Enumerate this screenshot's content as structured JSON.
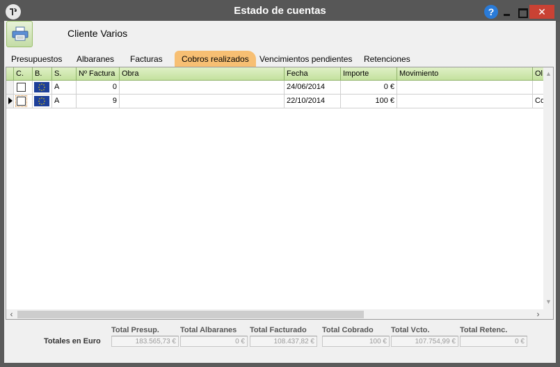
{
  "window": {
    "title": "Estado de cuentas",
    "help_label": "?",
    "close_label": "✕"
  },
  "client": {
    "name": "Cliente Varios"
  },
  "tabs": [
    {
      "label": "Presupuestos",
      "active": false
    },
    {
      "label": "Albaranes",
      "active": false
    },
    {
      "label": "Facturas",
      "active": false
    },
    {
      "label": "Cobros realizados",
      "active": true
    },
    {
      "label": "Vencimientos pendientes",
      "active": false
    },
    {
      "label": "Retenciones",
      "active": false
    }
  ],
  "grid": {
    "columns": [
      "C.",
      "B.",
      "S.",
      "Nº Factura",
      "Obra",
      "Fecha",
      "Importe",
      "Movimiento",
      "Ol"
    ],
    "rows": [
      {
        "checked": false,
        "serie": "A",
        "factura": "0",
        "obra": "",
        "fecha": "24/06/2014",
        "importe": "0 €",
        "movimiento": "",
        "extra": ""
      },
      {
        "checked": false,
        "serie": "A",
        "factura": "9",
        "obra": "",
        "fecha": "22/10/2014",
        "importe": "100 €",
        "movimiento": "",
        "extra": "Co"
      }
    ]
  },
  "totals": {
    "row_label": "Totales en Euro",
    "labels": {
      "presup": "Total Presup.",
      "albaranes": "Total Albaranes",
      "facturado": "Total Facturado",
      "cobrado": "Total Cobrado",
      "vcto": "Total Vcto.",
      "retenc": "Total Retenc."
    },
    "values": {
      "presup": "183.565,73 €",
      "albaranes": "0 €",
      "facturado": "108.437,82 €",
      "cobrado": "100 €",
      "vcto": "107.754,99 €",
      "retenc": "0 €"
    }
  },
  "colors": {
    "title_bar": "#575757",
    "active_tab": "#f7bf73",
    "grid_header": "#c4e19e",
    "close_button": "#c94234",
    "help_button": "#2a7bd8"
  },
  "icons": {
    "app": "app-logo-icon",
    "print": "printer-icon",
    "flag": "eu-flag-icon"
  }
}
